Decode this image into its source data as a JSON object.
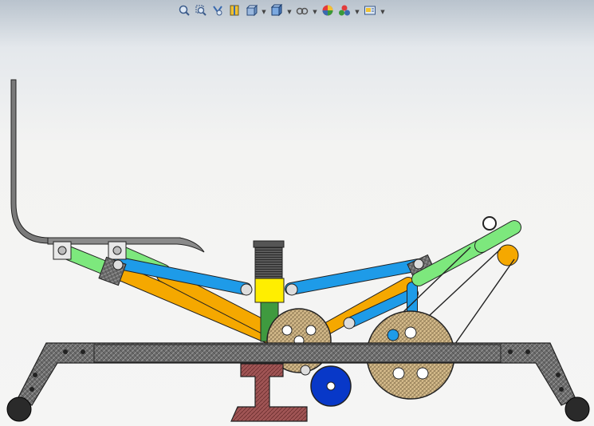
{
  "view_toolbar": {
    "tools": [
      {
        "icon": "zoom-to-fit-icon",
        "has_dropdown": false
      },
      {
        "icon": "zoom-to-area-icon",
        "has_dropdown": false
      },
      {
        "icon": "previous-view-icon",
        "has_dropdown": false
      },
      {
        "icon": "section-view-icon",
        "has_dropdown": false
      },
      {
        "icon": "view-orientation-icon",
        "has_dropdown": true
      },
      {
        "icon": "display-style-icon",
        "has_dropdown": true
      },
      {
        "icon": "hide-show-items-icon",
        "has_dropdown": true
      },
      {
        "icon": "edit-appearance-icon",
        "has_dropdown": false
      },
      {
        "icon": "apply-scene-icon",
        "has_dropdown": true
      },
      {
        "icon": "view-settings-icon",
        "has_dropdown": true
      }
    ]
  },
  "model": {
    "components": [
      "seat-backrest",
      "seat-pan",
      "front-link-green",
      "upper-link-blue-left",
      "upper-link-blue-right",
      "diagonal-link-orange-left",
      "diagonal-link-orange-right",
      "spring-damper",
      "slider-block-yellow",
      "gear-small",
      "gear-large",
      "pulley-blue",
      "belt",
      "base-frame",
      "pedestal",
      "right-link-green",
      "pivot-ring",
      "orange-roller"
    ]
  },
  "colors": {
    "link_green": "#7de87d",
    "link_blue": "#1e9be8",
    "link_orange": "#f5a800",
    "slider_yellow": "#ffee00",
    "column_green": "#3f9a3f",
    "pulley_blue": "#0838c8",
    "gear_tan": "#d9c09a",
    "frame_gray": "#6a6a6a",
    "pedestal_red": "#9a4a4a"
  }
}
